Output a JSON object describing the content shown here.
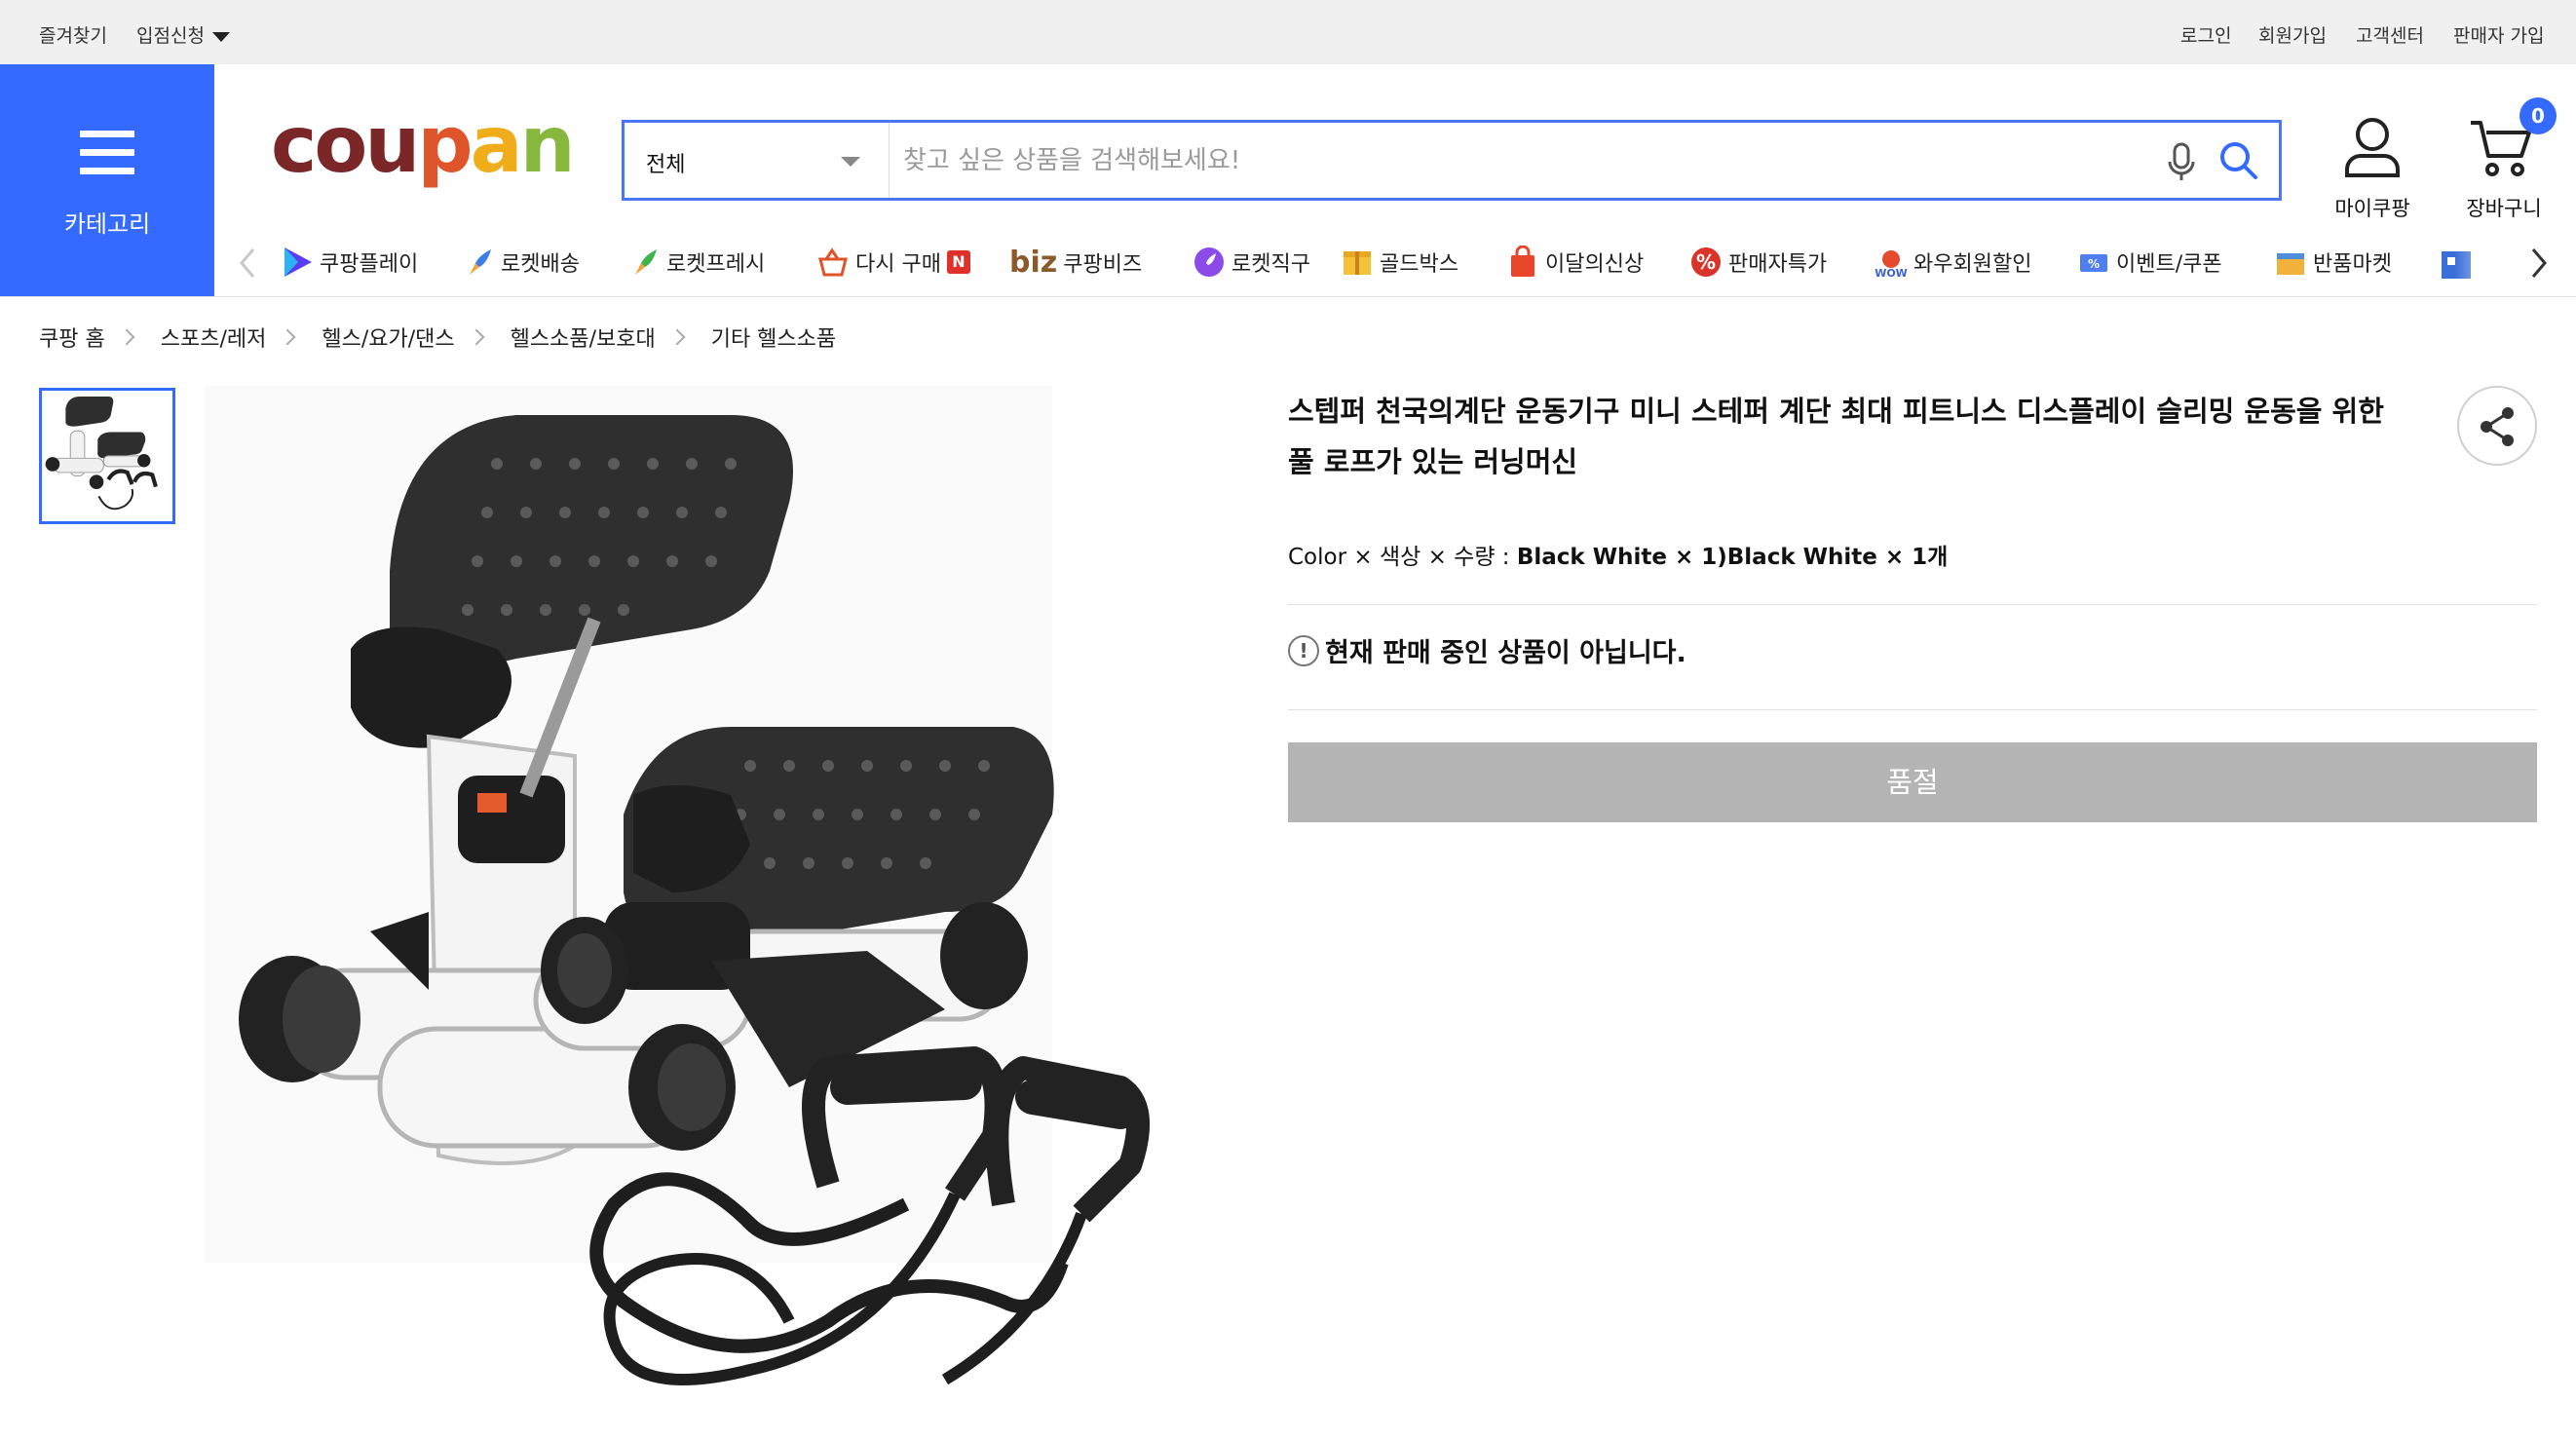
{
  "topbar": {
    "favorites": "즐겨찾기",
    "seller_apply": "입점신청",
    "login": "로그인",
    "signup": "회원가입",
    "customer_center": "고객센터",
    "seller_signup": "판매자 가입"
  },
  "category_button": {
    "label": "카테고리"
  },
  "logo": {
    "text_coup": "coup",
    "text_ang": "ang",
    "colors": [
      "#8a2b2b",
      "#e2592b",
      "#f2b21b",
      "#7cb342",
      "#2a9bd8",
      "#4a7fd4"
    ]
  },
  "search": {
    "category_selected": "전체",
    "placeholder": "찾고 싶은 상품을 검색해보세요!",
    "value": ""
  },
  "header_icons": {
    "mycoupang_label": "마이쿠팡",
    "cart_label": "장바구니",
    "cart_count": "0"
  },
  "nav_menu": {
    "items": [
      {
        "label": "쿠팡플레이",
        "icon": "play-icon"
      },
      {
        "label": "로켓배송",
        "icon": "rocket-icon"
      },
      {
        "label": "로켓프레시",
        "icon": "rocket-fresh-icon"
      },
      {
        "label": "다시 구매",
        "icon": "basket-icon",
        "badge": "N"
      },
      {
        "label": "쿠팡비즈",
        "icon": "biz-icon",
        "prefix": "biz"
      },
      {
        "label": "로켓직구",
        "icon": "global-rocket-icon"
      },
      {
        "label": "골드박스",
        "icon": "goldbox-icon"
      },
      {
        "label": "이달의신상",
        "icon": "new-bag-icon"
      },
      {
        "label": "판매자특가",
        "icon": "percent-icon"
      },
      {
        "label": "와우회원할인",
        "icon": "wow-icon"
      },
      {
        "label": "이벤트/쿠폰",
        "icon": "coupon-icon"
      },
      {
        "label": "반품마켓",
        "icon": "return-market-icon"
      }
    ]
  },
  "breadcrumb": [
    "쿠팡 홈",
    "스포츠/레저",
    "헬스/요가/댄스",
    "헬스소품/보호대",
    "기타 헬스소품"
  ],
  "product": {
    "title": "스텝퍼 천국의계단 운동기구 미니 스테퍼 계단 최대 피트니스 디스플레이 슬리밍 운동을 위한 풀 로프가 있는 러닝머신",
    "options_label": "Color × 색상 × 수량 : ",
    "options_value": "Black White × 1)Black White × 1개",
    "notice": "현재 판매 중인 상품이 아닙니다.",
    "soldout_button": "품절"
  },
  "colors": {
    "brand_blue": "#346aff",
    "soldout_gray": "#b4b4b4"
  }
}
